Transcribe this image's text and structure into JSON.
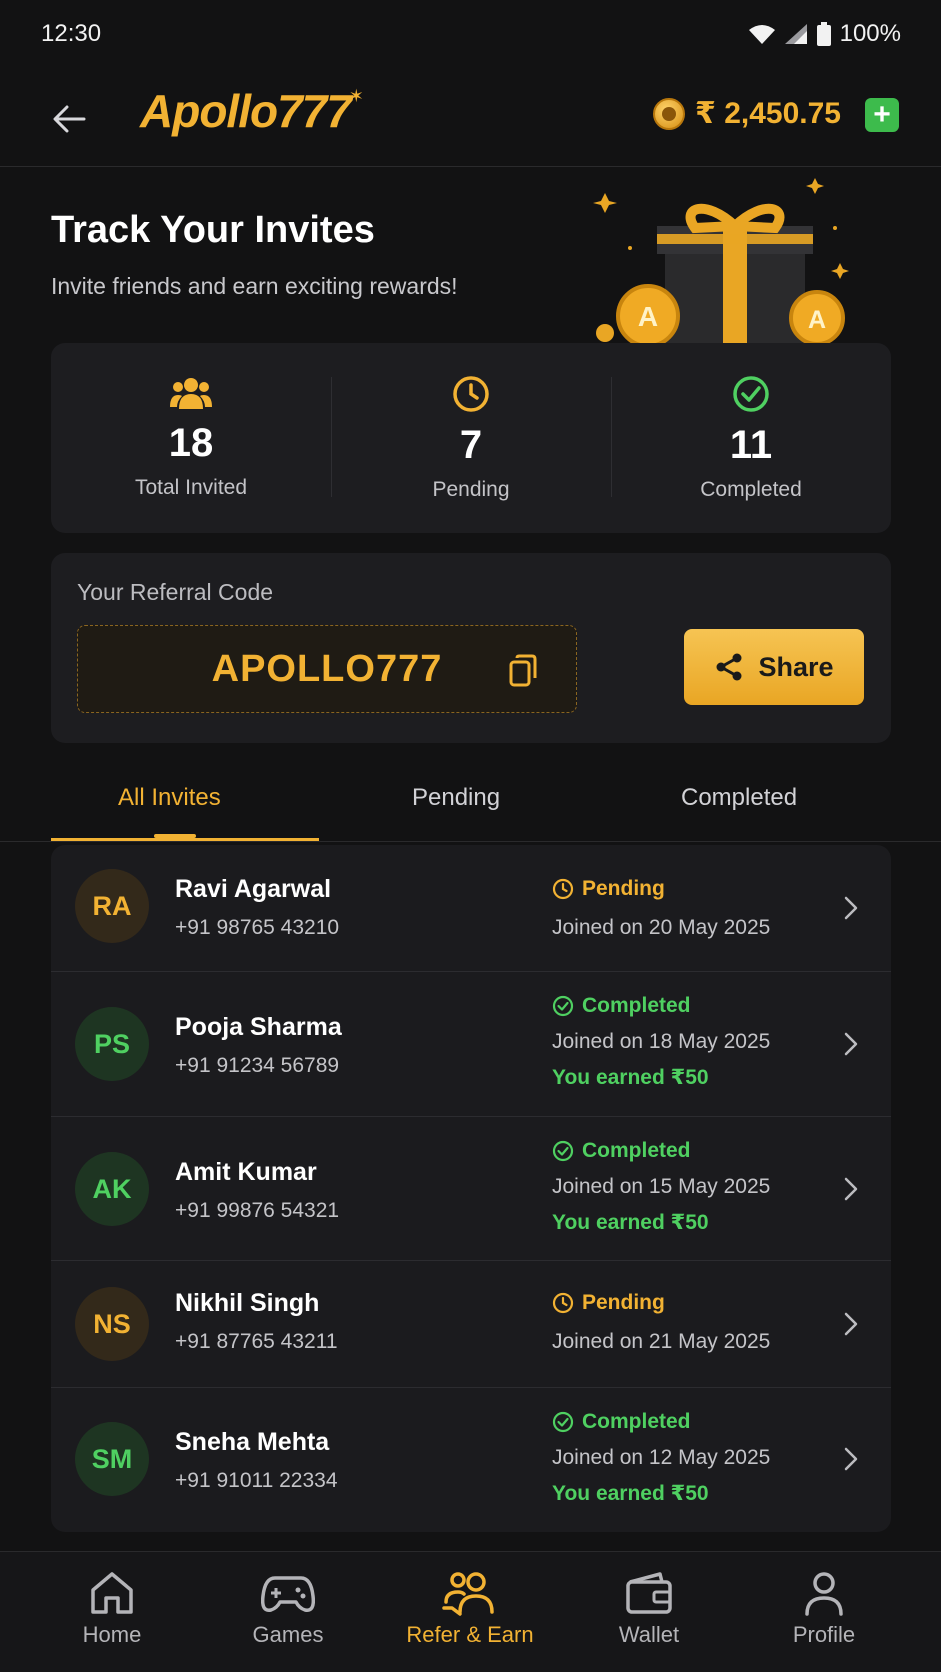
{
  "status_bar": {
    "time": "12:30",
    "battery": "100%"
  },
  "header": {
    "logo": "Apollo777",
    "balance": "₹ 2,450.75",
    "add_label": "+"
  },
  "hero": {
    "title": "Track Your Invites",
    "subtitle": "Invite friends and earn exciting rewards!"
  },
  "stats": [
    {
      "value": "18",
      "label": "Total Invited",
      "icon": "users-icon",
      "color": "#f2b233"
    },
    {
      "value": "7",
      "label": "Pending",
      "icon": "clock-icon",
      "color": "#f2b233"
    },
    {
      "value": "11",
      "label": "Completed",
      "icon": "check-circle-icon",
      "color": "#4fd061"
    }
  ],
  "referral": {
    "label": "Your Referral Code",
    "code": "APOLLO777",
    "share_label": "Share"
  },
  "tabs": [
    {
      "label": "All Invites",
      "active": true
    },
    {
      "label": "Pending",
      "active": false
    },
    {
      "label": "Completed",
      "active": false
    }
  ],
  "invites": [
    {
      "initials": "RA",
      "name": "Ravi Agarwal",
      "phone": "+91 98765 43210",
      "status": "Pending",
      "joined": "Joined on 20 May 2025",
      "earned": ""
    },
    {
      "initials": "PS",
      "name": "Pooja Sharma",
      "phone": "+91 91234 56789",
      "status": "Completed",
      "joined": "Joined on 18 May 2025",
      "earned": "You earned ₹50"
    },
    {
      "initials": "AK",
      "name": "Amit Kumar",
      "phone": "+91 99876 54321",
      "status": "Completed",
      "joined": "Joined on 15 May 2025",
      "earned": "You earned ₹50"
    },
    {
      "initials": "NS",
      "name": "Nikhil Singh",
      "phone": "+91 87765 43211",
      "status": "Pending",
      "joined": "Joined on 21 May 2025",
      "earned": ""
    },
    {
      "initials": "SM",
      "name": "Sneha Mehta",
      "phone": "+91 91011 22334",
      "status": "Completed",
      "joined": "Joined on 12 May 2025",
      "earned": "You earned ₹50"
    }
  ],
  "nav": [
    {
      "label": "Home",
      "icon": "home-icon",
      "active": false
    },
    {
      "label": "Games",
      "icon": "gamepad-icon",
      "active": false
    },
    {
      "label": "Refer & Earn",
      "icon": "refer-icon",
      "active": true
    },
    {
      "label": "Wallet",
      "icon": "wallet-icon",
      "active": false
    },
    {
      "label": "Profile",
      "icon": "profile-icon",
      "active": false
    }
  ],
  "colors": {
    "accent": "#f2b233",
    "success": "#4fd061",
    "background": "#121213",
    "card": "#1d1d20"
  }
}
